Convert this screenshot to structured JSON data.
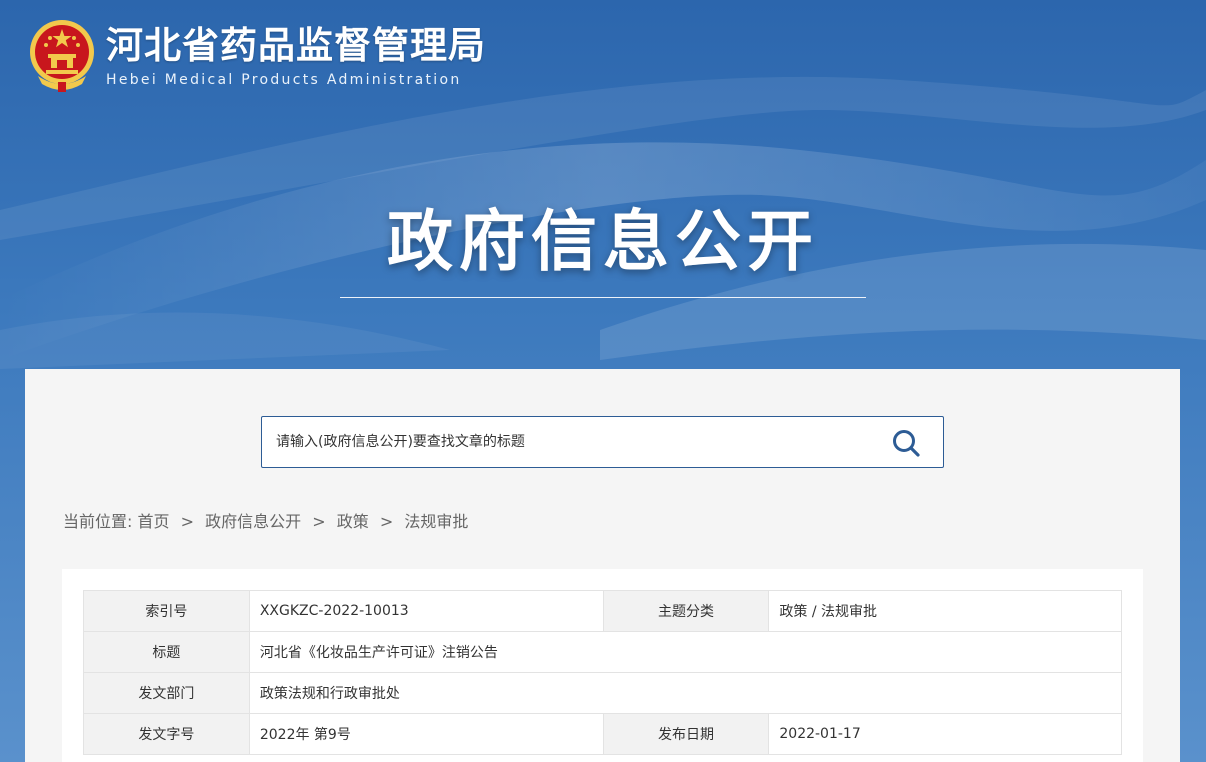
{
  "header": {
    "site_title": "河北省药品监督管理局",
    "site_subtitle": "Hebei Medical Products Administration",
    "emblem": "national-emblem-icon"
  },
  "hero": {
    "heading": "政府信息公开"
  },
  "search": {
    "placeholder": "请输入(政府信息公开)要查找文章的标题",
    "icon": "search-icon"
  },
  "breadcrumb": {
    "prefix": "当前位置:",
    "items": [
      "首页",
      "政府信息公开",
      "政策",
      "法规审批"
    ],
    "separator": ">"
  },
  "info_table": {
    "index_label": "索引号",
    "index_value": "XXGKZC-2022-10013",
    "topic_label": "主题分类",
    "topic_value": "政策 / 法规审批",
    "title_label": "标题",
    "title_value": "河北省《化妆品生产许可证》注销公告",
    "dept_label": "发文部门",
    "dept_value": "政策法规和行政审批处",
    "docno_label": "发文字号",
    "docno_value": "2022年 第9号",
    "date_label": "发布日期",
    "date_value": "2022-01-17"
  },
  "colors": {
    "banner_blue": "#2f6db3",
    "search_border": "#2d5c95",
    "panel_bg": "#f5f5f5",
    "emblem_red": "#c8161d",
    "emblem_gold": "#f2c94c"
  }
}
